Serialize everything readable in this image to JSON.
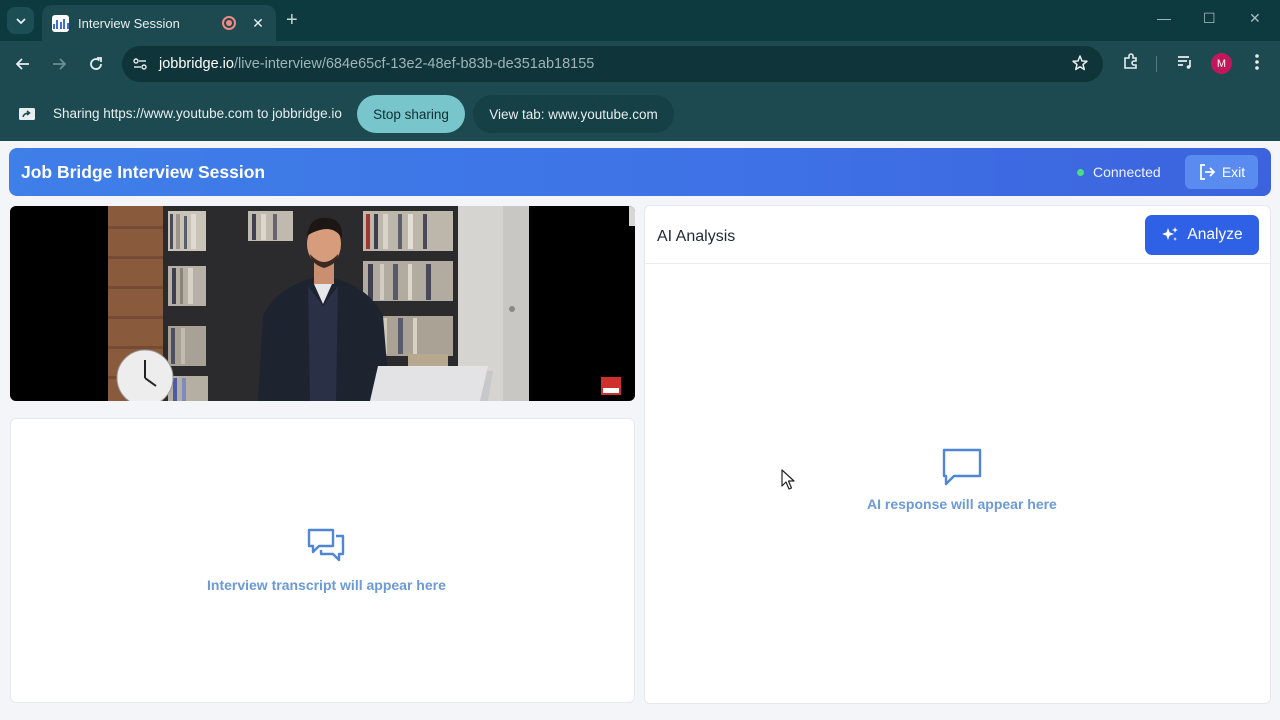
{
  "browser": {
    "tab": {
      "title": "Interview Session",
      "close_glyph": "✕"
    },
    "new_tab_glyph": "+",
    "window_controls": {
      "minimize": "—",
      "maximize": "☐",
      "close": "✕"
    },
    "url": {
      "host": "jobbridge.io",
      "path": "/live-interview/684e65cf-13e2-48ef-b83b-de351ab18155"
    },
    "profile_initial": "M",
    "sharing": {
      "text": "Sharing https://www.youtube.com to jobbridge.io",
      "stop_label": "Stop sharing",
      "view_label": "View tab: www.youtube.com"
    }
  },
  "app": {
    "title": "Job Bridge Interview Session",
    "status": "Connected",
    "exit_label": "Exit"
  },
  "transcript": {
    "placeholder": "Interview transcript will appear here"
  },
  "ai": {
    "title": "AI Analysis",
    "analyze_label": "Analyze",
    "placeholder": "AI response will appear here"
  },
  "colors": {
    "chrome_dark": "#0d3a3f",
    "chrome": "#1c4a50",
    "header_blue": "#3f7fe8",
    "analyze_blue": "#2f61e6",
    "status_green": "#4ade80",
    "placeholder_blue": "#6b9ad6"
  }
}
